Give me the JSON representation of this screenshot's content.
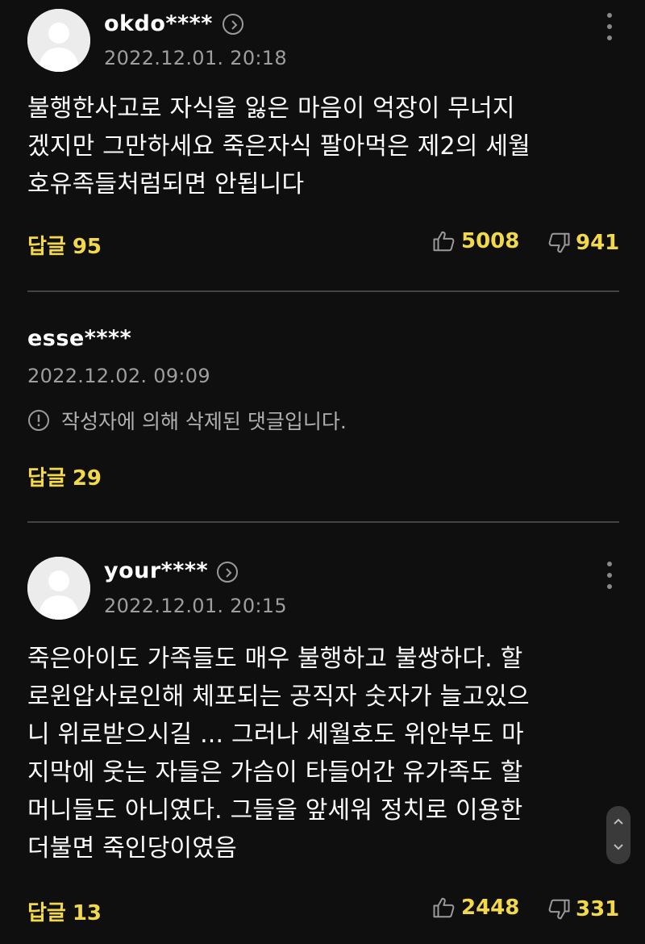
{
  "comments": [
    {
      "username": "okdo****",
      "date": "2022.12.01. 20:18",
      "text": "불행한사고로 자식을 잃은 마음이 억장이 무너지\n겠지만 그만하세요 죽은자식 팔아먹은 제2의 세월\n호유족들처럼되면 안됩니다",
      "reply_label": "답글",
      "reply_count": "95",
      "likes": "5008",
      "dislikes": "941"
    },
    {
      "username": "esse****",
      "date": "2022.12.02. 09:09",
      "deleted_message": "작성자에 의해 삭제된 댓글입니다.",
      "reply_label": "답글",
      "reply_count": "29"
    },
    {
      "username": "your****",
      "date": "2022.12.01. 20:15",
      "text": "죽은아이도 가족들도 매우 불행하고 불쌍하다. 할\n로윈압사로인해 체포되는 공직자 숫자가 늘고있으\n니 위로받으시길 ... 그러나 세월호도 위안부도 마\n지막에 웃는 자들은 가슴이 타들어간 유가족도 할\n머니들도 아니였다. 그들을 앞세워 정치로 이용한\n더불면 죽인당이였음",
      "reply_label": "답글",
      "reply_count": "13",
      "likes": "2448",
      "dislikes": "331"
    }
  ],
  "icons": {
    "avatar": "default-user-avatar-icon",
    "profile": "chevron-right-circle-icon",
    "more": "more-vertical-icon",
    "like": "thumbs-up-icon",
    "dislike": "thumbs-down-icon",
    "deleted": "alert-circle-icon",
    "scroll": "scroll-up-down-icon"
  },
  "colors": {
    "background": "#0f0f0f",
    "accent": "#f2d84b",
    "meta_text": "#9e9e9e",
    "divider": "#444444"
  }
}
